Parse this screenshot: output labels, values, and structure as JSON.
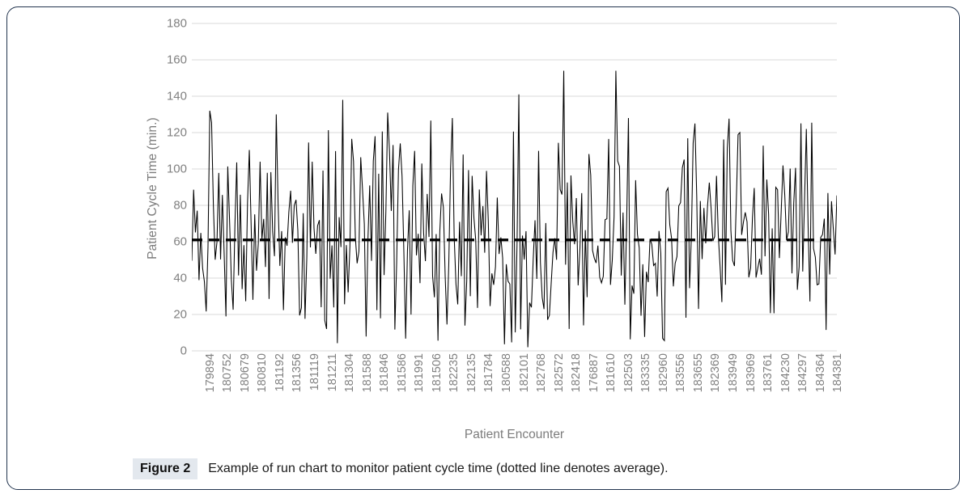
{
  "figure": {
    "badge": "Figure 2",
    "caption": "Example of run chart to monitor patient cycle time (dotted line denotes average)."
  },
  "chart_data": {
    "type": "line",
    "title": "",
    "xlabel": "Patient Encounter",
    "ylabel": "Patient Cycle Time (min.)",
    "ylim": [
      0,
      180
    ],
    "yticks": [
      0,
      20,
      40,
      60,
      80,
      100,
      120,
      140,
      160,
      180
    ],
    "grid": true,
    "legend": "none",
    "n_points": 360,
    "value_range": [
      2,
      154
    ],
    "annotations": [
      {
        "kind": "average-line",
        "label": "dotted line denotes average",
        "value": 61,
        "style": "dashed",
        "color": "#000000"
      }
    ],
    "xtick_labels": [
      "179894",
      "180752",
      "180679",
      "180810",
      "181192",
      "181356",
      "181119",
      "181211",
      "181304",
      "181588",
      "181846",
      "181586",
      "181991",
      "181506",
      "182235",
      "182135",
      "181784",
      "180588",
      "182101",
      "182768",
      "182572",
      "182418",
      "176887",
      "181610",
      "182503",
      "183335",
      "182960",
      "183556",
      "183655",
      "182369",
      "183949",
      "183969",
      "183761",
      "184230",
      "184297",
      "184364",
      "184381"
    ],
    "series": [
      {
        "name": "Patient Cycle Time",
        "color": "#000000",
        "mean": 61,
        "min": 2,
        "max": 154,
        "notable_peaks": [
          132,
          130,
          138,
          131,
          128,
          141,
          154,
          128,
          125,
          120,
          122
        ]
      }
    ]
  },
  "colors": {
    "border": "#23354f",
    "gridline": "#d9d9d9",
    "axis_text": "#808080",
    "axis_title": "#7c7c7c",
    "series": "#000000",
    "badge_bg": "#e3e8ee"
  }
}
